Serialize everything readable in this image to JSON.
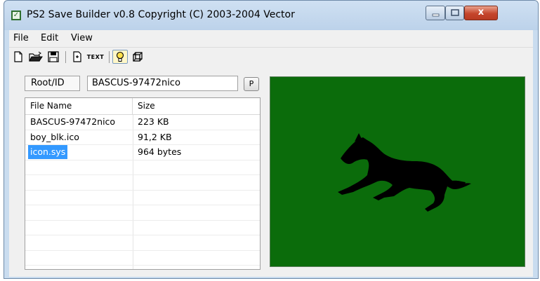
{
  "window": {
    "title": "PS2 Save Builder v0.8 Copyright (C) 2003-2004 Vector",
    "icon": "app-check-icon",
    "controls": {
      "minimize": "minimize-icon",
      "maximize": "maximize-icon",
      "close": "close-icon",
      "close_glyph": "x"
    }
  },
  "menu": {
    "file": "File",
    "edit": "Edit",
    "view": "View"
  },
  "toolbar": {
    "new_icon": "new-file-icon",
    "open_icon": "open-folder-icon",
    "save_icon": "save-disk-icon",
    "add_icon": "add-file-icon",
    "text_label": "TEXT",
    "light_icon": "lightbulb-icon",
    "cube_icon": "cube-icon"
  },
  "root": {
    "label": "Root/ID",
    "value": "BASCUS-97472nico",
    "p_button": "P"
  },
  "files": {
    "columns": [
      "File Name",
      "Size"
    ],
    "rows": [
      {
        "name": "BASCUS-97472nico",
        "size": "223 KB",
        "selected": false
      },
      {
        "name": "boy_blk.ico",
        "size": "91,2 KB",
        "selected": false
      },
      {
        "name": "icon.sys",
        "size": "964 bytes",
        "selected": true
      }
    ],
    "empty_rows": 7
  },
  "preview": {
    "background": "#0b6c0b",
    "subject": "horse-silhouette"
  }
}
